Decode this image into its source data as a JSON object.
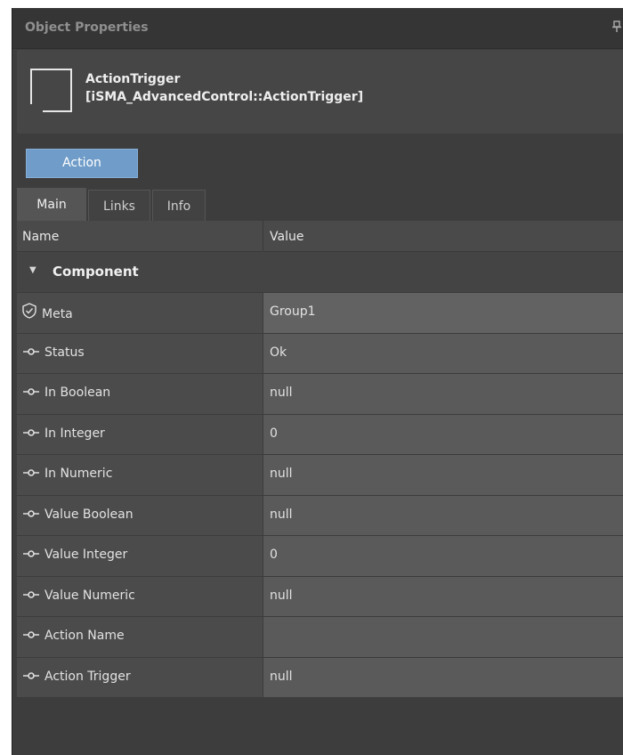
{
  "panel": {
    "title": "Object Properties",
    "pin_icon": "pin-icon"
  },
  "object": {
    "name": "ActionTrigger",
    "type": "[iSMA_AdvancedControl::ActionTrigger]",
    "icon": "component-icon"
  },
  "actions": {
    "action_label": "Action"
  },
  "tabs": [
    {
      "label": "Main",
      "active": true
    },
    {
      "label": "Links",
      "active": false
    },
    {
      "label": "Info",
      "active": false
    }
  ],
  "grid": {
    "col_name": "Name",
    "col_value": "Value",
    "group": "Component",
    "meta": {
      "name": "Meta",
      "value": "Group1",
      "icon": "meta-shield-icon"
    },
    "slots": [
      {
        "name": "Status",
        "value": "Ok"
      },
      {
        "name": "In Boolean",
        "value": "null"
      },
      {
        "name": "In Integer",
        "value": "0"
      },
      {
        "name": "In Numeric",
        "value": "null"
      },
      {
        "name": "Value Boolean",
        "value": "null"
      },
      {
        "name": "Value Integer",
        "value": "0"
      },
      {
        "name": "Value Numeric",
        "value": "null"
      },
      {
        "name": "Action Name",
        "value": ""
      },
      {
        "name": "Action Trigger",
        "value": "null"
      }
    ]
  },
  "colors": {
    "accent_button": "#6f9cc8",
    "panel_bg": "#3d3d3d",
    "value_cell": "#5a5a5a",
    "name_cell": "#4b4b4b"
  }
}
